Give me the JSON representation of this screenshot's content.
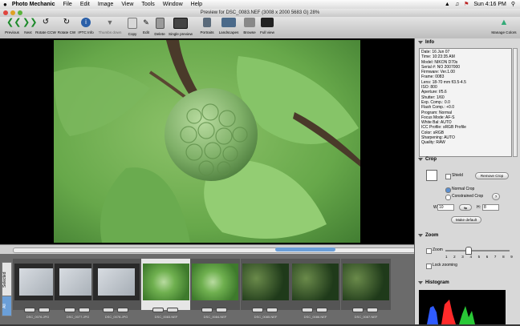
{
  "menubar": {
    "app": "Photo Mechanic",
    "items": [
      "File",
      "Edit",
      "Image",
      "View",
      "Tools",
      "Window",
      "Help"
    ],
    "time": "Sun 4:16 PM"
  },
  "window": {
    "title": "Preview for DSC_0083.NEF (3008 x 2000 5683 G) 28%"
  },
  "toolbar": {
    "buttons": [
      "Previous",
      "Next",
      "Rotate CCW",
      "Rotate CW",
      "IPTC Info",
      "Thumbs down",
      "Copy",
      "Edit",
      "Delete",
      "Single preview",
      "Portraits",
      "Landscapes",
      "Browse",
      "Full view"
    ],
    "manage_colors": "Manage Colors"
  },
  "filmstrip": {
    "tabs": [
      "All",
      "Selected"
    ],
    "thumbs": [
      {
        "name": "DSC_0076.JPG",
        "kind": "doc"
      },
      {
        "name": "DSC_0077.JPG",
        "kind": "doc"
      },
      {
        "name": "DSC_0078.JPG",
        "kind": "doc"
      },
      {
        "name": "DSC_0083.NEF",
        "kind": "leaf",
        "selected": true
      },
      {
        "name": "DSC_0084.NEF",
        "kind": "leaf"
      },
      {
        "name": "DSC_0085.NEF",
        "kind": "forest"
      },
      {
        "name": "DSC_0086.NEF",
        "kind": "forest"
      },
      {
        "name": "DSC_0087.NEF",
        "kind": "forest"
      }
    ]
  },
  "info_panel": {
    "title": "Info",
    "lines": [
      "Date: 16 Jun 07",
      "Time: 10:23:35 AM",
      "Model: NIKON D70s",
      "Serial #: NO 2007000",
      "Firmware: Ver.1.00",
      "Frame: 0083",
      "Lens: 18-70 mm f/3.5-4.5",
      "ISO: 800",
      "Aperture: f/5.6",
      "Shutter: 1/60",
      "Exp. Comp.: 0.0",
      "Flash Comp.: +0.0",
      "Program: Normal",
      "Focus Mode: AF-S",
      "White Bal: AUTO",
      "ICC Profile: sRGB Profile",
      "Color: sRGB",
      "Sharpening: AUTO",
      "Quality: RAW"
    ]
  },
  "crop_panel": {
    "title": "Crop",
    "shield": "Shield",
    "remove_crop": "Remove Crop",
    "normal_crop": "Normal Crop",
    "constrained_crop": "Constrained Crop",
    "w_label": "W:",
    "w_value": "10",
    "h_label": "H:",
    "h_value": "8",
    "make_default": "Make default"
  },
  "zoom_panel": {
    "title": "Zoom",
    "zoom_label": "Zoom",
    "scale": "1 2 3 4 5 6 7 8 9",
    "lock_zooming": "Lock zooming",
    "value_fraction": 0.35
  },
  "histogram_panel": {
    "title": "Histogram"
  },
  "colors": {
    "selected_thumb": "#e6e6e6",
    "scroll_thumb": "#6b9fd8"
  }
}
